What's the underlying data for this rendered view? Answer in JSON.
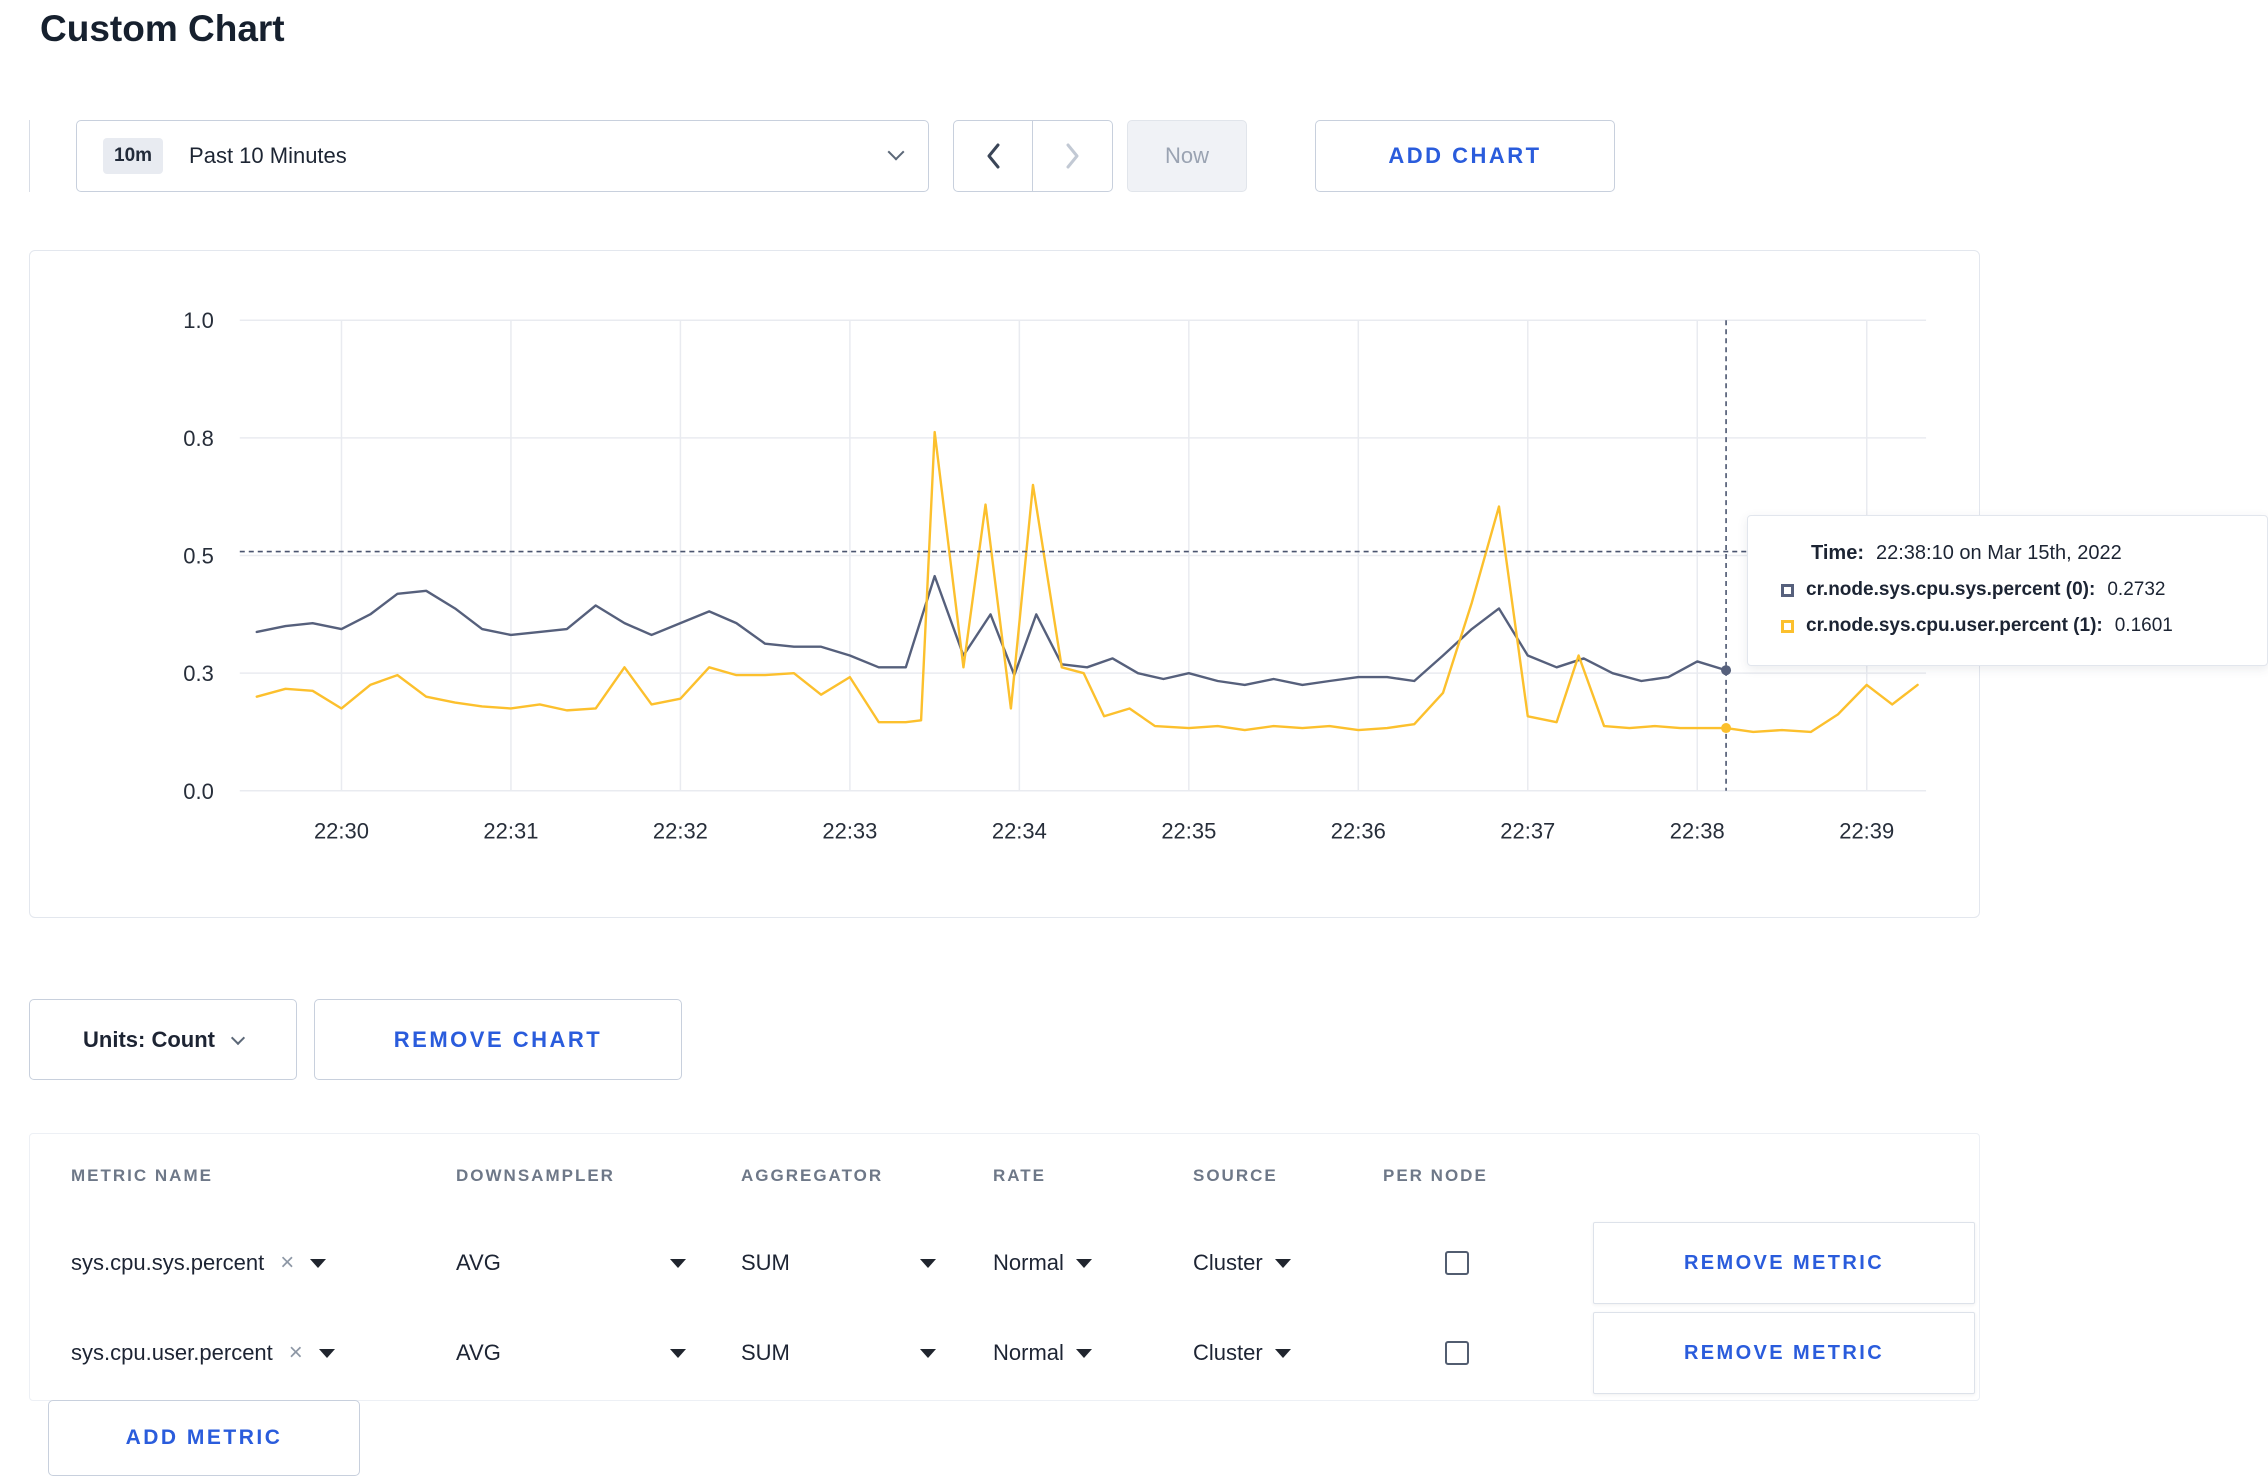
{
  "page": {
    "title": "Custom Chart"
  },
  "icons": {
    "clear": "×"
  },
  "colors": {
    "accent_blue": "#2a5cdc",
    "grid": "#e9ebf0",
    "crosshair": "#4a546f",
    "series_sys": "#56607c",
    "series_user": "#fcc02d"
  },
  "toolbar": {
    "range_badge": "10m",
    "range_label": "Past 10 Minutes",
    "now_label": "Now",
    "add_chart_label": "ADD CHART"
  },
  "chart_data": {
    "type": "line",
    "title": "",
    "xlabel": "",
    "ylabel": "",
    "x_domain": [
      29.4,
      39.35
    ],
    "x_ticks": [
      {
        "minute": 30,
        "label": "22:30"
      },
      {
        "minute": 31,
        "label": "22:31"
      },
      {
        "minute": 32,
        "label": "22:32"
      },
      {
        "minute": 33,
        "label": "22:33"
      },
      {
        "minute": 34,
        "label": "22:34"
      },
      {
        "minute": 35,
        "label": "22:35"
      },
      {
        "minute": 36,
        "label": "22:36"
      },
      {
        "minute": 37,
        "label": "22:37"
      },
      {
        "minute": 38,
        "label": "22:38"
      },
      {
        "minute": 39,
        "label": "22:39"
      }
    ],
    "y_ticks": [
      {
        "value": 1.0,
        "label": "1.0"
      },
      {
        "value": 0.8,
        "label": "0.8"
      },
      {
        "value": 0.5,
        "label": "0.5"
      },
      {
        "value": 0.3,
        "label": "0.3"
      },
      {
        "value": 0.0,
        "label": "0.0"
      }
    ],
    "series": [
      {
        "name": "cr.node.sys.cpu.sys.percent",
        "color": "#56607c",
        "points": [
          [
            29.5,
            0.37
          ],
          [
            29.67,
            0.38
          ],
          [
            29.83,
            0.385
          ],
          [
            30.0,
            0.375
          ],
          [
            30.17,
            0.4
          ],
          [
            30.33,
            0.435
          ],
          [
            30.5,
            0.44
          ],
          [
            30.67,
            0.41
          ],
          [
            30.83,
            0.375
          ],
          [
            31.0,
            0.365
          ],
          [
            31.17,
            0.37
          ],
          [
            31.33,
            0.375
          ],
          [
            31.5,
            0.415
          ],
          [
            31.67,
            0.385
          ],
          [
            31.83,
            0.365
          ],
          [
            32.0,
            0.385
          ],
          [
            32.17,
            0.405
          ],
          [
            32.33,
            0.385
          ],
          [
            32.5,
            0.35
          ],
          [
            32.67,
            0.345
          ],
          [
            32.83,
            0.345
          ],
          [
            33.0,
            0.33
          ],
          [
            33.17,
            0.31
          ],
          [
            33.33,
            0.31
          ],
          [
            33.5,
            0.465
          ],
          [
            33.67,
            0.33
          ],
          [
            33.83,
            0.4
          ],
          [
            33.97,
            0.295
          ],
          [
            34.1,
            0.4
          ],
          [
            34.25,
            0.315
          ],
          [
            34.4,
            0.31
          ],
          [
            34.55,
            0.325
          ],
          [
            34.7,
            0.3
          ],
          [
            34.85,
            0.285
          ],
          [
            35.0,
            0.3
          ],
          [
            35.17,
            0.28
          ],
          [
            35.33,
            0.27
          ],
          [
            35.5,
            0.285
          ],
          [
            35.67,
            0.27
          ],
          [
            35.83,
            0.28
          ],
          [
            36.0,
            0.29
          ],
          [
            36.17,
            0.29
          ],
          [
            36.33,
            0.28
          ],
          [
            36.5,
            0.33
          ],
          [
            36.67,
            0.375
          ],
          [
            36.83,
            0.41
          ],
          [
            37.0,
            0.33
          ],
          [
            37.17,
            0.31
          ],
          [
            37.33,
            0.325
          ],
          [
            37.5,
            0.3
          ],
          [
            37.67,
            0.28
          ],
          [
            37.83,
            0.29
          ],
          [
            38.0,
            0.32
          ],
          [
            38.17,
            0.305
          ]
        ]
      },
      {
        "name": "cr.node.sys.cpu.user.percent",
        "color": "#fcc02d",
        "points": [
          [
            29.5,
            0.24
          ],
          [
            29.67,
            0.26
          ],
          [
            29.83,
            0.255
          ],
          [
            30.0,
            0.21
          ],
          [
            30.17,
            0.27
          ],
          [
            30.33,
            0.295
          ],
          [
            30.5,
            0.24
          ],
          [
            30.67,
            0.225
          ],
          [
            30.83,
            0.215
          ],
          [
            31.0,
            0.21
          ],
          [
            31.17,
            0.22
          ],
          [
            31.33,
            0.205
          ],
          [
            31.5,
            0.21
          ],
          [
            31.67,
            0.31
          ],
          [
            31.83,
            0.22
          ],
          [
            32.0,
            0.235
          ],
          [
            32.17,
            0.31
          ],
          [
            32.33,
            0.295
          ],
          [
            32.5,
            0.295
          ],
          [
            32.67,
            0.3
          ],
          [
            32.83,
            0.245
          ],
          [
            33.0,
            0.29
          ],
          [
            33.17,
            0.175
          ],
          [
            33.33,
            0.175
          ],
          [
            33.42,
            0.18
          ],
          [
            33.5,
            0.81
          ],
          [
            33.67,
            0.31
          ],
          [
            33.8,
            0.63
          ],
          [
            33.95,
            0.21
          ],
          [
            34.08,
            0.68
          ],
          [
            34.25,
            0.31
          ],
          [
            34.38,
            0.3
          ],
          [
            34.5,
            0.19
          ],
          [
            34.65,
            0.21
          ],
          [
            34.8,
            0.165
          ],
          [
            35.0,
            0.16
          ],
          [
            35.17,
            0.165
          ],
          [
            35.33,
            0.155
          ],
          [
            35.5,
            0.165
          ],
          [
            35.67,
            0.16
          ],
          [
            35.83,
            0.165
          ],
          [
            36.0,
            0.155
          ],
          [
            36.17,
            0.16
          ],
          [
            36.33,
            0.17
          ],
          [
            36.5,
            0.25
          ],
          [
            36.67,
            0.42
          ],
          [
            36.83,
            0.625
          ],
          [
            37.0,
            0.19
          ],
          [
            37.17,
            0.175
          ],
          [
            37.3,
            0.33
          ],
          [
            37.45,
            0.165
          ],
          [
            37.6,
            0.16
          ],
          [
            37.75,
            0.165
          ],
          [
            37.9,
            0.16
          ],
          [
            38.05,
            0.16
          ],
          [
            38.17,
            0.16
          ],
          [
            38.33,
            0.15
          ],
          [
            38.5,
            0.155
          ],
          [
            38.67,
            0.15
          ],
          [
            38.83,
            0.195
          ],
          [
            39.0,
            0.27
          ],
          [
            39.15,
            0.22
          ],
          [
            39.3,
            0.27
          ]
        ]
      }
    ],
    "crosshair": {
      "x_minute": 38.17,
      "y_value": 0.51,
      "markers": [
        {
          "series": 0,
          "value": 0.305
        },
        {
          "series": 1,
          "value": 0.16
        }
      ]
    }
  },
  "tooltip": {
    "time_label": "Time:",
    "time_value": "22:38:10 on Mar 15th, 2022",
    "series": [
      {
        "label": "cr.node.sys.cpu.sys.percent (0):",
        "value": "0.2732"
      },
      {
        "label": "cr.node.sys.cpu.user.percent (1):",
        "value": "0.1601"
      }
    ]
  },
  "chart_controls": {
    "units_label": "Units: Count",
    "remove_chart_label": "REMOVE CHART"
  },
  "metrics_table": {
    "headers": [
      "METRIC NAME",
      "DOWNSAMPLER",
      "AGGREGATOR",
      "RATE",
      "SOURCE",
      "PER NODE"
    ],
    "rows": [
      {
        "metric": "sys.cpu.sys.percent",
        "downsampler": "AVG",
        "aggregator": "SUM",
        "rate": "Normal",
        "source": "Cluster",
        "per_node": false,
        "remove_label": "REMOVE METRIC"
      },
      {
        "metric": "sys.cpu.user.percent",
        "downsampler": "AVG",
        "aggregator": "SUM",
        "rate": "Normal",
        "source": "Cluster",
        "per_node": false,
        "remove_label": "REMOVE METRIC"
      }
    ],
    "add_metric_label": "ADD METRIC"
  }
}
